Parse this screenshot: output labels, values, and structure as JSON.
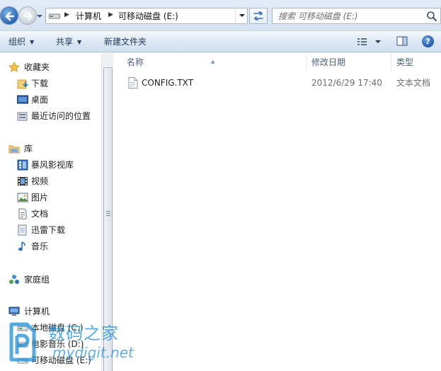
{
  "address_bar": {
    "segments": [
      "计算机",
      "可移动磁盘 (E:)"
    ],
    "search_placeholder": "搜索 可移动磁盘 (E:)"
  },
  "toolbar": {
    "organize": "组织",
    "share": "共享",
    "new_folder": "新建文件夹"
  },
  "sidebar": {
    "favorites": {
      "label": "收藏夹",
      "items": [
        "下载",
        "桌面",
        "最近访问的位置"
      ]
    },
    "libraries": {
      "label": "库",
      "items": [
        "暴风影视库",
        "视频",
        "图片",
        "文档",
        "迅雷下载",
        "音乐"
      ]
    },
    "homegroup": "家庭组",
    "computer": {
      "label": "计算机",
      "items": [
        "本地磁盘 (C:)",
        "电影音乐 (D:)",
        "可移动磁盘 (E:)"
      ]
    }
  },
  "file_list": {
    "columns": [
      "名称",
      "修改日期",
      "类型"
    ],
    "rows": [
      {
        "name": "CONFIG.TXT",
        "modified": "2012/6/29 17:40",
        "type": "文本文档"
      }
    ]
  },
  "watermark": {
    "cn": "数码之家",
    "en": "mydigit.net"
  },
  "colors": {
    "accent": "#1e395b",
    "nav_orb": "#2d66b5",
    "watermark": "#1d8fd8"
  }
}
